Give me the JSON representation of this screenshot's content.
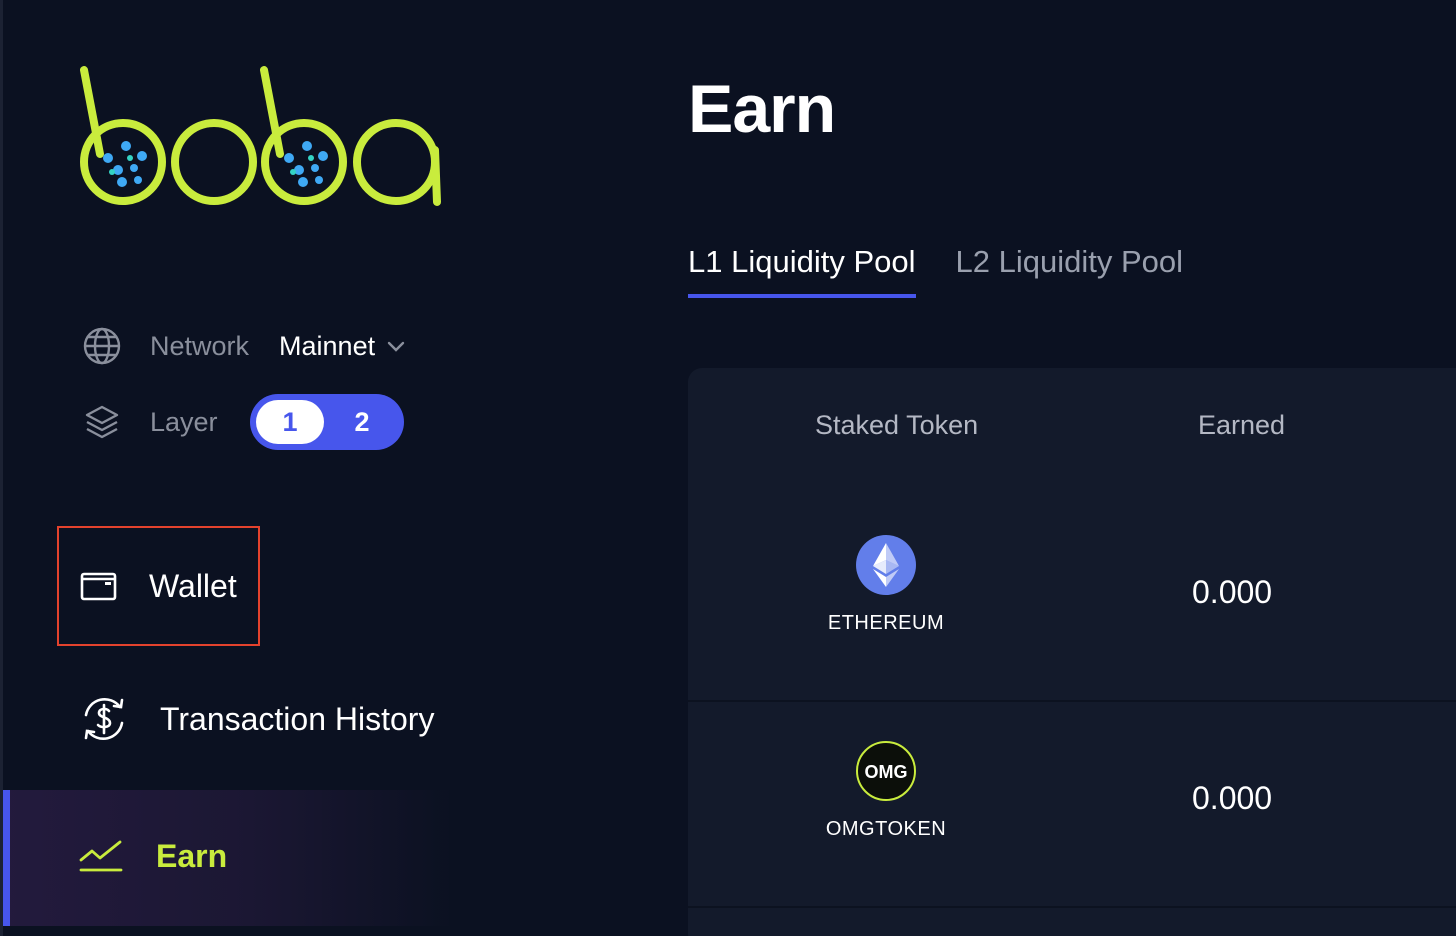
{
  "colors": {
    "accent": "#4756ec",
    "brand_green": "#c9ec3d",
    "background": "#0b1121",
    "highlight_border": "#e4422d"
  },
  "sidebar": {
    "logo_icon": "boba-logo",
    "network": {
      "icon": "globe-icon",
      "label": "Network",
      "value": "Mainnet"
    },
    "layer": {
      "icon": "layers-icon",
      "label": "Layer",
      "options": [
        "1",
        "2"
      ],
      "selected": "1"
    },
    "nav": [
      {
        "icon": "wallet-icon",
        "label": "Wallet"
      },
      {
        "icon": "transaction-history-icon",
        "label": "Transaction History"
      },
      {
        "icon": "chart-line-icon",
        "label": "Earn",
        "active": true
      }
    ]
  },
  "main": {
    "title": "Earn",
    "tabs": [
      {
        "label": "L1 Liquidity Pool",
        "active": true
      },
      {
        "label": "L2 Liquidity Pool",
        "active": false
      }
    ],
    "table": {
      "headers": {
        "token": "Staked Token",
        "earned": "Earned"
      },
      "rows": [
        {
          "icon": "ethereum-icon",
          "token": "ETHEREUM",
          "earned": "0.000"
        },
        {
          "icon": "omg-icon",
          "icon_text": "OMG",
          "token": "OMGTOKEN",
          "earned": "0.000"
        }
      ]
    }
  }
}
